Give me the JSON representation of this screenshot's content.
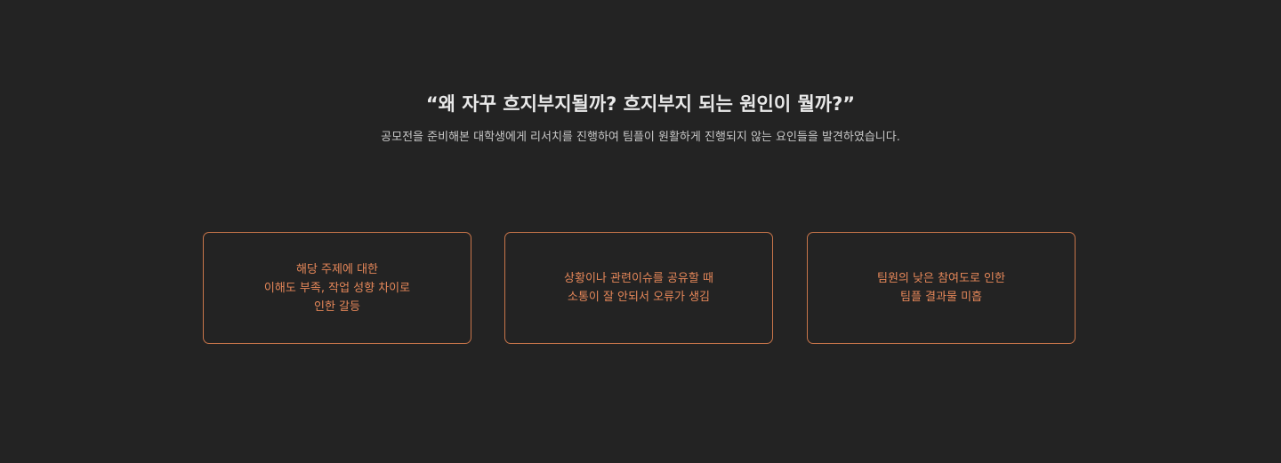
{
  "hero": {
    "headline": "“왜 자꾸 흐지부지될까? 흐지부지 되는 원인이 뭘까?”",
    "subtitle": "공모전을 준비해본 대학생에게 리서치를 진행하여 팀플이 원활하게 진행되지 않는 요인들을 발견하였습니다."
  },
  "cards": [
    {
      "lines": [
        "해당 주제에 대한",
        "이해도 부족, 작업 성향 차이로",
        "인한 갈등"
      ]
    },
    {
      "lines": [
        "상황이나 관련이슈를 공유할 때",
        "소통이 잘 안되서 오류가 생김"
      ]
    },
    {
      "lines": [
        "팀원의 낮은 참여도로 인한",
        "팀플 결과물 미흡"
      ]
    }
  ],
  "colors": {
    "background": "#232323",
    "accent": "#e58759",
    "card_border": "#c8754a",
    "headline": "#e9e9e9",
    "subtitle": "#c7c7c7"
  }
}
